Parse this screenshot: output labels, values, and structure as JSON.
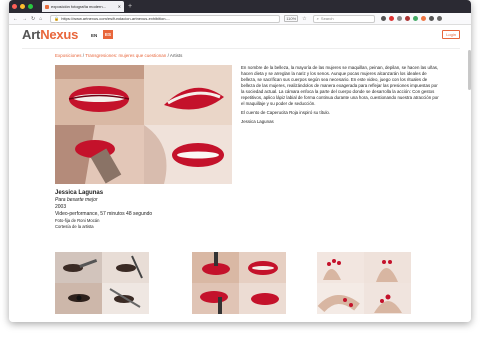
{
  "browser": {
    "tab_title": "exposición fotografía modern...",
    "tab_close": "✕",
    "new_tab": "+",
    "url": "https://www.artnexus.com/es/fundacion-artnexus-exhibition-...",
    "zoom": "110%",
    "search_placeholder": "Search"
  },
  "site": {
    "logo_art": "Art",
    "logo_nexus": "Nexus",
    "lang_en": "EN",
    "lang_es": "ES",
    "login": "Login"
  },
  "breadcrumb": {
    "item1": "Exposiciones",
    "sep": " / ",
    "item2": "Transgresiones: mujeres que cuestionan",
    "item3": "Artists"
  },
  "description": {
    "p1": "En nombre de la belleza, la mayoría de las mujeres se maquillan, peinan, depilan, se hacen las uñas, hacen dieta y se arreglan la nariz y los senos. Aunque pocas mujeres alcanzarán los ideales de belleza, se sacrifican sus cuerpos según sea necesario. En este video, juego con los rituales de belleza de las mujeres, realizándolos de manera exagerada para reflejar las presiones impuestas por la sociedad actual. La cámara enfoca la parte del cuerpo donde se desarrolla la acción: Con gestos repetitivos, aplico lápiz labial de forma continua durante una hora, cuestionando nuestra atracción por el maquillaje y su poder de seducción.",
    "p2": "El cuento de Caperucita Roja inspiró su título.",
    "p3": "Jessica Lagunas"
  },
  "artwork": {
    "artist": "Jessica Lagunas",
    "title": "Para besarte mejor",
    "year": "2003",
    "technique": "Video-performance, 57 minutos 48 segundo",
    "photo_credit": "Foto-fija de Roni Mocán",
    "courtesy": "Cortesía de la artista"
  },
  "colors": {
    "accent": "#e8663b",
    "lipstick": "#c4122b"
  }
}
